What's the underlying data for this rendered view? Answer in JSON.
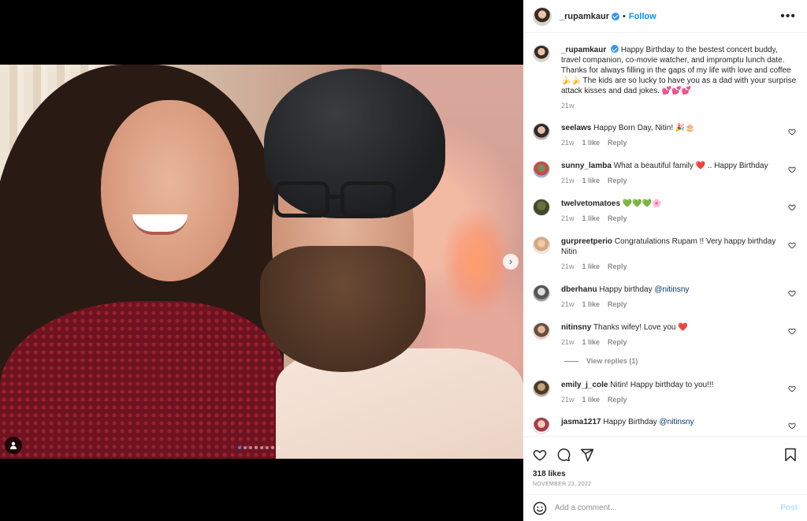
{
  "post": {
    "username": "_rupamkaur",
    "follow_label": "Follow",
    "separator": "•",
    "more_icon": "more-horizontal-icon"
  },
  "caption": {
    "username": "_rupamkaur",
    "text": "Happy Birthday to the bestest concert buddy, travel companion, co-movie watcher, and impromptu lunch date. Thanks for always filling in the gaps of my life with love and coffee 🍌🍌 The kids are so lucky to have you as a dad with your surprise attack kisses and dad jokes. 💕💕💕",
    "time": "21w"
  },
  "comments": [
    {
      "username": "seelaws",
      "text": "Happy Born Day, Nitin! 🎉🎂",
      "time": "21w",
      "likes": "1 like",
      "reply": "Reply"
    },
    {
      "username": "sunny_lamba",
      "text": "What a beautiful family ❤️ .. Happy Birthday",
      "time": "21w",
      "likes": "1 like",
      "reply": "Reply"
    },
    {
      "username": "twelvetomatoes",
      "text": "💚💚💚🌸",
      "time": "21w",
      "likes": "1 like",
      "reply": "Reply"
    },
    {
      "username": "gurpreetperio",
      "text": "Congratulations Rupam !! Very happy birthday Nitin",
      "time": "21w",
      "likes": "1 like",
      "reply": "Reply"
    },
    {
      "username": "dberhanu",
      "text": "Happy birthday ",
      "mention": "@nitinsny",
      "time": "21w",
      "likes": "1 like",
      "reply": "Reply"
    },
    {
      "username": "nitinsny",
      "text": "Thanks wifey! Love you ❤️",
      "time": "21w",
      "likes": "1 like",
      "reply": "Reply"
    },
    {
      "username": "emily_j_cole",
      "text": "Nitin! Happy birthday to you!!!",
      "time": "21w",
      "likes": "1 like",
      "reply": "Reply"
    },
    {
      "username": "jasma1217",
      "text": "Happy Birthday ",
      "mention": "@nitinsny",
      "time": "",
      "likes": "",
      "reply": ""
    }
  ],
  "view_replies": "View replies (1)",
  "likes_count": "318 likes",
  "date": "NOVEMBER 23, 2022",
  "add_comment": {
    "placeholder": "Add a comment...",
    "post_label": "Post"
  },
  "carousel": {
    "total": 8,
    "active": 0
  },
  "colors": {
    "accent": "#0095f6",
    "verified": "#3897f0",
    "heart": "#ed4956"
  }
}
